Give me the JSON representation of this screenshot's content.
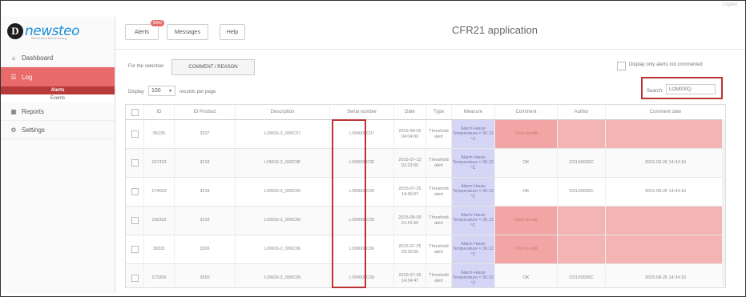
{
  "logout": "Logout",
  "brand": {
    "name": "newsteo",
    "tagline": "Wireless Monitoring"
  },
  "sidebar": {
    "items": [
      {
        "label": "Dashboard",
        "icon": "home-icon"
      },
      {
        "label": "Log",
        "icon": "list-icon",
        "active": true
      },
      {
        "label": "Reports",
        "icon": "report-icon"
      },
      {
        "label": "Settings",
        "icon": "settings-icon"
      }
    ],
    "sub_items": [
      {
        "label": "Alerts",
        "active": true
      },
      {
        "label": "Events"
      }
    ]
  },
  "header": {
    "alerts_label": "Alerts",
    "alerts_badge": "5000",
    "messages_label": "Messages",
    "help_label": "Help",
    "app_title": "CFR21 application"
  },
  "toolbar": {
    "selection_label": "For the selection",
    "comment_button": "COMMENT / REASON",
    "only_uncommented_label": "Display only alerts not commented",
    "display_label": "Display",
    "page_length": "100",
    "records_label": "records per page",
    "search_label": "Search:",
    "search_value": "LOM000Q"
  },
  "colors": {
    "accent": "#e86a6a",
    "accent_dark": "#b83a3a",
    "measure_bg": "#d5d5f5",
    "uncommented_bg": "#f2a5a5",
    "highlight_border": "#b33333",
    "brand": "#1a8fd6"
  },
  "table": {
    "columns": [
      "",
      "ID",
      "ID Product",
      "Description",
      "Serial number",
      "Date",
      "Type",
      "Measure",
      "Comment",
      "Author",
      "Comment date"
    ],
    "rows": [
      {
        "id": "95235",
        "product": "3207",
        "description": "LOM16-2_000C07",
        "serial": "LOM000C07",
        "date": "2015-08-05 04:04:00",
        "type": "Threshold alert",
        "measure": "Alarm Haute Temperature = 30.12 °C",
        "comment": "Click to edit",
        "author": "",
        "comment_date": "",
        "uncommented": true
      },
      {
        "id": "167433",
        "product": "3218",
        "description": "LOM16-2_000C0F",
        "serial": "LOM000C0F",
        "date": "2015-07-13 02:23:00",
        "type": "Threshold alert",
        "measure": "Alarm Haute Temperature = 30.12 °C",
        "comment": "OK",
        "author": "COL00000C",
        "comment_date": "2015-08-26 14:34:16",
        "uncommented": false
      },
      {
        "id": "174033",
        "product": "3218",
        "description": "LOM16-2_000C00",
        "serial": "LOM000C00",
        "date": "2015-07-25 14:40:07",
        "type": "Threshold alert",
        "measure": "Alarm Haute Temperature = 30.12 °C",
        "comment": "OK",
        "author": "COL00000C",
        "comment_date": "2015-08-26 14:34:16",
        "uncommented": false
      },
      {
        "id": "106332",
        "product": "3218",
        "description": "LOM16-2_000C00",
        "serial": "LOM000C00",
        "date": "2015-08-09 21:41:50",
        "type": "Threshold alert",
        "measure": "Alarm Haute Temperature = 30.12 °C",
        "comment": "Click to edit",
        "author": "",
        "comment_date": "",
        "uncommented": true
      },
      {
        "id": "39331",
        "product": "3206",
        "description": "LOM16-2_000C06",
        "serial": "LOM000C06",
        "date": "2015-07-25 20:30:50",
        "type": "Threshold alert",
        "measure": "Alarm Haute Temperature = 30.12 °C",
        "comment": "Click to edit",
        "author": "",
        "comment_date": "",
        "uncommented": true
      },
      {
        "id": "173306",
        "product": "3250",
        "description": "LOM16-2_000C09",
        "serial": "LOM000C09",
        "date": "2015-07-25 14:34:47",
        "type": "Threshold alert",
        "measure": "Alarm Haute Temperature = 30.12 °C",
        "comment": "OK",
        "author": "COL00000C",
        "comment_date": "2015-08-26 14:34:16",
        "uncommented": false
      }
    ]
  }
}
